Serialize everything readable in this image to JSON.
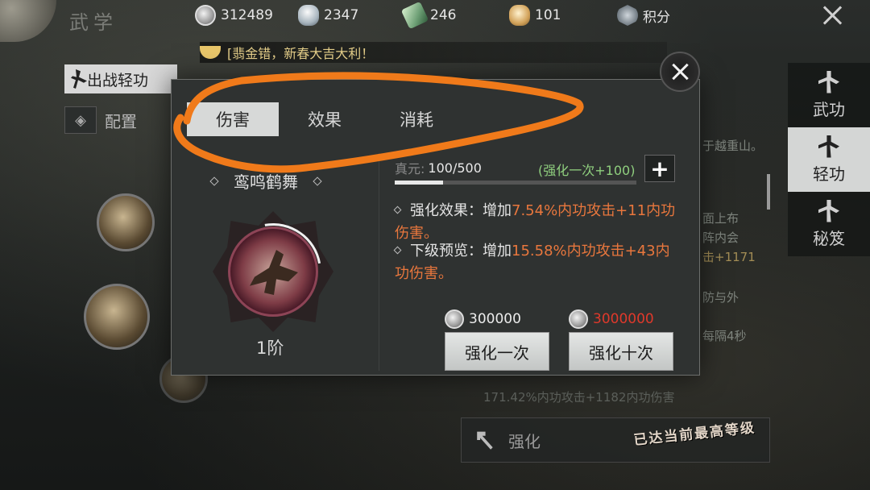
{
  "background": {
    "title": "武学",
    "left_tab": "出战轻功",
    "config_label": "配置",
    "enhance_label": "强化",
    "max_level_stamp": "已达当前最高等级",
    "summary": "171.42%内功攻击+1182内功伤害",
    "right_fragments": [
      "于越重山。",
      "面上布",
      "阵内会",
      "击+1171",
      "防与外",
      "每隔4秒"
    ]
  },
  "resources": [
    {
      "icon": "coin-icon",
      "value": "312489"
    },
    {
      "icon": "silver-icon",
      "value": "2347"
    },
    {
      "icon": "jade-ticket-icon",
      "value": "246"
    },
    {
      "icon": "ingot-icon",
      "value": "101"
    },
    {
      "icon": "score-icon",
      "value": "积分"
    }
  ],
  "marquee": "[翡金错，新春大吉大利！",
  "sidenav": [
    {
      "label": "武功",
      "active": false
    },
    {
      "label": "轻功",
      "active": true
    },
    {
      "label": "秘笈",
      "active": false
    }
  ],
  "modal": {
    "tabs": [
      {
        "label": "伤害",
        "active": true
      },
      {
        "label": "效果",
        "active": false
      },
      {
        "label": "消耗",
        "active": false
      }
    ],
    "skill_name": "鸾鸣鹤舞",
    "level": "1阶",
    "xp_prefix": "真元:",
    "xp": "100/500",
    "xp_progress": 0.2,
    "strength_hint": "(强化一次+100)",
    "effect_current_prefix": "强化效果：增加",
    "effect_current_value": "7.54%内功攻击+11内功伤害。",
    "effect_next_prefix": "下级预览：增加",
    "effect_next_value": "15.58%内功攻击+43内功伤害。",
    "cost_once": "300000",
    "cost_ten": "3000000",
    "btn_once": "强化一次",
    "btn_ten": "强化十次"
  },
  "colors": {
    "highlight": "#e9773d",
    "green_hint": "#8fcf7e",
    "cost_red": "#e0392b",
    "annotation": "#f07a1a"
  }
}
